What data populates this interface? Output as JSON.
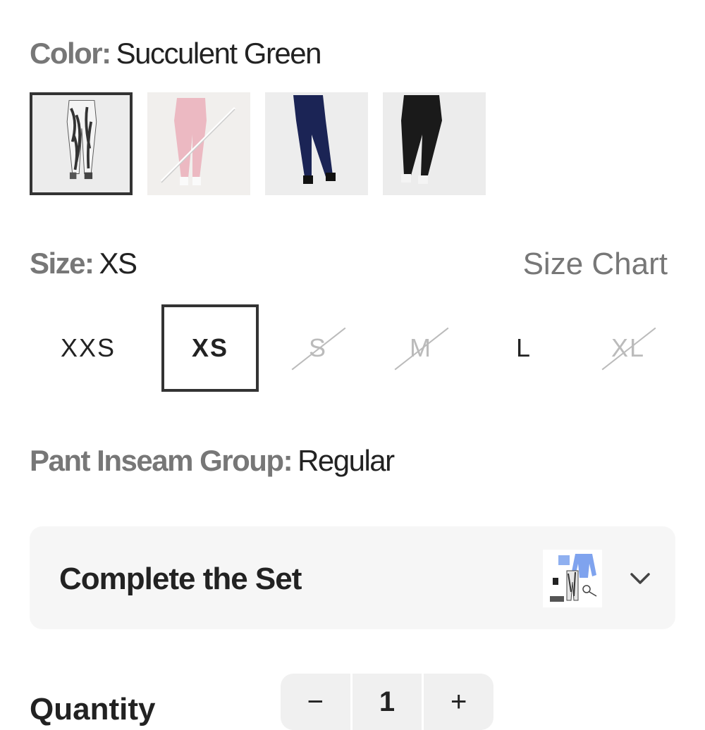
{
  "color": {
    "label": "Color:",
    "value": "Succulent Green"
  },
  "swatches": [
    {
      "name": "white-black-print",
      "selected": true,
      "available": true
    },
    {
      "name": "pink",
      "selected": false,
      "available": false
    },
    {
      "name": "navy",
      "selected": false,
      "available": true
    },
    {
      "name": "black",
      "selected": false,
      "available": true
    }
  ],
  "size": {
    "label": "Size:",
    "value": "XS",
    "chart_link": "Size Chart"
  },
  "sizes": [
    {
      "label": "XXS",
      "selected": false,
      "available": true
    },
    {
      "label": "XS",
      "selected": true,
      "available": true
    },
    {
      "label": "S",
      "selected": false,
      "available": false
    },
    {
      "label": "M",
      "selected": false,
      "available": false
    },
    {
      "label": "L",
      "selected": false,
      "available": true
    },
    {
      "label": "XL",
      "selected": false,
      "available": false
    }
  ],
  "inseam": {
    "label": "Pant Inseam Group:",
    "value": "Regular"
  },
  "complete_set": {
    "title": "Complete the Set",
    "icon": "chevron-down-icon"
  },
  "quantity": {
    "label": "Quantity",
    "value": "1",
    "decrement": "−",
    "increment": "+"
  }
}
